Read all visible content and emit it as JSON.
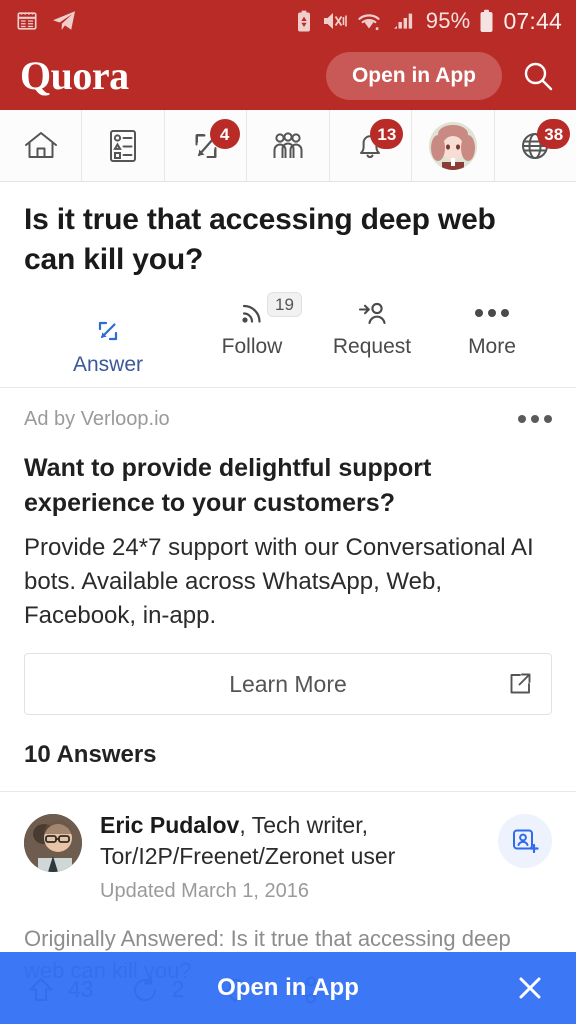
{
  "status_bar": {
    "left_icons": [
      "calendar-icon",
      "telegram-icon"
    ],
    "right_icons": [
      "battery-saver-icon",
      "mute-vibrate-icon",
      "wifi-icon",
      "signal-icon"
    ],
    "battery_percent": "95%",
    "time": "07:44"
  },
  "header": {
    "logo": "Quora",
    "open_in_app_label": "Open in App",
    "search_icon": "search-icon"
  },
  "navbar": {
    "items": [
      {
        "name": "home",
        "icon": "home-icon",
        "badge": ""
      },
      {
        "name": "feed",
        "icon": "list-icon",
        "badge": ""
      },
      {
        "name": "write",
        "icon": "write-icon",
        "badge": "4"
      },
      {
        "name": "spaces",
        "icon": "people-icon",
        "badge": ""
      },
      {
        "name": "notifications",
        "icon": "bell-icon",
        "badge": "13"
      },
      {
        "name": "profile",
        "icon": "avatar-icon",
        "badge": ""
      },
      {
        "name": "language",
        "icon": "globe-icon",
        "badge": "38"
      }
    ]
  },
  "question": {
    "title": "Is it true that accessing deep web can kill you?",
    "actions": [
      {
        "label": "Answer",
        "icon": "pencil-square-icon",
        "badge": ""
      },
      {
        "label": "Follow",
        "icon": "rss-follow-icon",
        "badge": "19"
      },
      {
        "label": "Request",
        "icon": "person-arrow-icon",
        "badge": ""
      },
      {
        "label": "More",
        "icon": "ellipsis-icon",
        "badge": ""
      }
    ]
  },
  "ad": {
    "attribution": "Ad by Verloop.io",
    "menu_icon": "ellipsis-icon",
    "title": "Want to provide delightful support experience to your customers?",
    "body": "Provide 24*7 support with our Conversational AI bots. Available across WhatsApp, Web, Facebook, in-app.",
    "cta_label": "Learn More",
    "cta_icon": "external-link-icon"
  },
  "answers": {
    "count_label": "10 Answers",
    "items": [
      {
        "author_name": "Eric Pudalov",
        "author_credential": ", Tech writer, Tor/I2P/Freenet/Zeronet user",
        "date": "Updated March 1, 2016",
        "follow_icon": "add-person-icon",
        "originally_answered": "Originally Answered: Is it true that accessing deep web can kill you?",
        "upvotes": "43",
        "comments": "2",
        "upvote_icon": "upvote-arrow-icon",
        "comment_icon": "comment-icon",
        "downvote_icon": "downvote-arrow-icon",
        "share_icon": "share-icon"
      }
    ]
  },
  "bottom_bar": {
    "label": "Open in App",
    "close_icon": "close-icon"
  },
  "colors": {
    "brand_red": "#b92b27",
    "accent_blue": "#2d6ef5",
    "badge_red": "#b92b27",
    "link_blue": "#3b5998"
  }
}
